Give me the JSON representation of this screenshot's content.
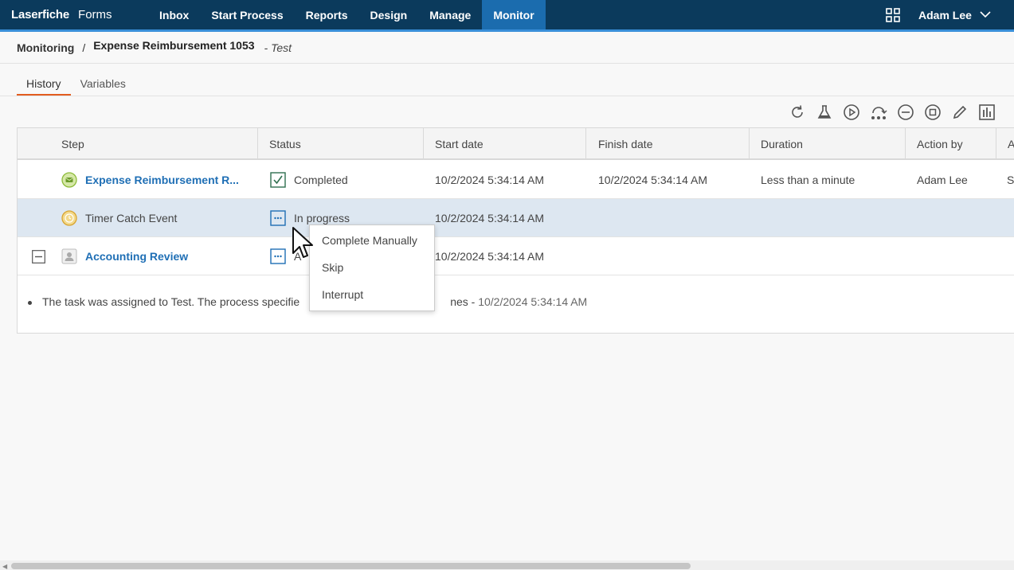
{
  "app": {
    "brand": "Laserfiche",
    "product": "Forms"
  },
  "nav": {
    "items": [
      {
        "label": "Inbox"
      },
      {
        "label": "Start Process"
      },
      {
        "label": "Reports"
      },
      {
        "label": "Design"
      },
      {
        "label": "Manage"
      },
      {
        "label": "Monitor",
        "active": true
      }
    ],
    "user": "Adam Lee"
  },
  "breadcrumb": {
    "root": "Monitoring",
    "separator": "/",
    "current": "Expense Reimbursement 1053",
    "suffix": "- Test"
  },
  "tabs": [
    {
      "label": "History",
      "active": true
    },
    {
      "label": "Variables"
    }
  ],
  "toolbar": {
    "icons": [
      "refresh-icon",
      "test-flask-icon",
      "resume-icon",
      "reroute-icon",
      "terminate-icon",
      "stop-icon",
      "edit-icon",
      "chart-icon"
    ]
  },
  "grid": {
    "columns": [
      "Step",
      "Status",
      "Start date",
      "Finish date",
      "Duration",
      "Action by",
      "A"
    ],
    "rows": [
      {
        "step": "Expense Reimbursement R...",
        "step_icon": "message-start-icon",
        "status": "Completed",
        "status_icon": "check-icon",
        "start": "10/2/2024 5:34:14 AM",
        "finish": "10/2/2024 5:34:14 AM",
        "duration": "Less than a minute",
        "action_by": "Adam Lee",
        "extra": "Su"
      },
      {
        "step": "Timer Catch Event",
        "step_icon": "timer-icon",
        "status": "In progress",
        "status_icon": "in-progress-icon",
        "start": "10/2/2024 5:34:14 AM",
        "finish": "",
        "duration": "",
        "action_by": "",
        "extra": ""
      },
      {
        "step": "Accounting Review",
        "step_icon": "user-task-icon",
        "status": "A",
        "status_icon": "in-progress-icon",
        "start": "10/2/2024 5:34:14 AM",
        "finish": "",
        "duration": "",
        "action_by": "",
        "extra": ""
      }
    ],
    "detail_note": {
      "text_start": "The task was assigned to Test. The process specifie",
      "text_end": "nes -",
      "timestamp": "10/2/2024 5:34:14 AM"
    }
  },
  "context_menu": {
    "items": [
      "Complete Manually",
      "Skip",
      "Interrupt"
    ]
  },
  "colors": {
    "topbar": "#0b3a5c",
    "nav_active": "#1b6cae",
    "tab_accent": "#e25c1f",
    "link": "#1f6fb5",
    "selected_row": "#dde7f1"
  }
}
